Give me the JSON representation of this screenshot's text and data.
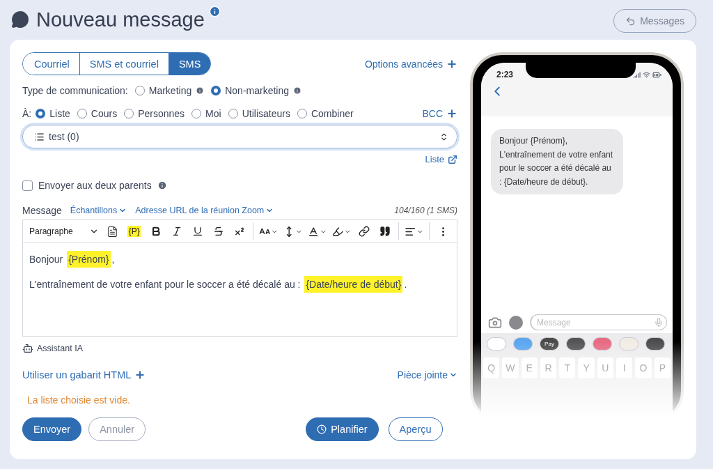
{
  "header": {
    "title": "Nouveau message",
    "back_button": "Messages"
  },
  "channel_tabs": [
    {
      "label": "Courriel",
      "selected": false
    },
    {
      "label": "SMS et courriel",
      "selected": false
    },
    {
      "label": "SMS",
      "selected": true
    }
  ],
  "advanced_options": "Options avancées",
  "communication_type": {
    "label": "Type de communication:",
    "options": [
      {
        "label": "Marketing",
        "selected": false
      },
      {
        "label": "Non-marketing",
        "selected": true
      }
    ]
  },
  "recipients": {
    "label": "À:",
    "options": [
      {
        "label": "Liste",
        "selected": true
      },
      {
        "label": "Cours",
        "selected": false
      },
      {
        "label": "Personnes",
        "selected": false
      },
      {
        "label": "Moi",
        "selected": false
      },
      {
        "label": "Utilisateurs",
        "selected": false
      },
      {
        "label": "Combiner",
        "selected": false
      }
    ],
    "bcc": "BCC"
  },
  "list_select": {
    "value": "test (0)"
  },
  "list_link": "Liste",
  "both_parents": {
    "label": "Envoyer aux deux parents",
    "checked": false
  },
  "message": {
    "label": "Message",
    "menus": [
      "Échantillons",
      "Adresse URL de la réunion Zoom"
    ],
    "counter": "104/160 (1 SMS)",
    "toolbar": {
      "block_style": "Paragraphe",
      "placeholder_button": "{P}"
    },
    "paragraphs": [
      [
        {
          "kind": "text",
          "text": "Bonjour "
        },
        {
          "kind": "field",
          "text": "{Prénom}"
        },
        {
          "kind": "text",
          "text": ","
        }
      ],
      [
        {
          "kind": "text",
          "text": "L'entraînement de votre enfant pour le soccer a été décalé au : "
        },
        {
          "kind": "field",
          "text": "{Date/heure de début}"
        },
        {
          "kind": "text",
          "text": "."
        }
      ]
    ]
  },
  "assistant": "Assistant IA",
  "html_template": "Utiliser un gabarit HTML",
  "attachment": "Pièce jointe",
  "warning": "La liste choisie est vide.",
  "left_actions": [
    {
      "label": "Envoyer",
      "kind": "primary"
    },
    {
      "label": "Annuler",
      "kind": "muted"
    }
  ],
  "right_actions": [
    {
      "label": "Planifier",
      "kind": "schedule"
    },
    {
      "label": "Aperçu",
      "kind": "outline"
    }
  ],
  "phone": {
    "time": "2:23",
    "bubble": "Bonjour {Prénom}, L'entraînement de votre enfant pour le soccer a été décalé au : {Date/heure de début}.",
    "input_placeholder": "Message",
    "apps": [
      {
        "color": "#ffffff"
      },
      {
        "color": "#5aa7f0"
      },
      {
        "color": "#4a4a4a",
        "label": "Pay"
      },
      {
        "color": "#555555"
      },
      {
        "color": "#e86b84"
      },
      {
        "color": "#f1ece4"
      },
      {
        "color": "#4d4d4d"
      }
    ],
    "keys": [
      "Q",
      "W",
      "E",
      "R",
      "T",
      "Y",
      "U",
      "I",
      "O",
      "P"
    ]
  }
}
